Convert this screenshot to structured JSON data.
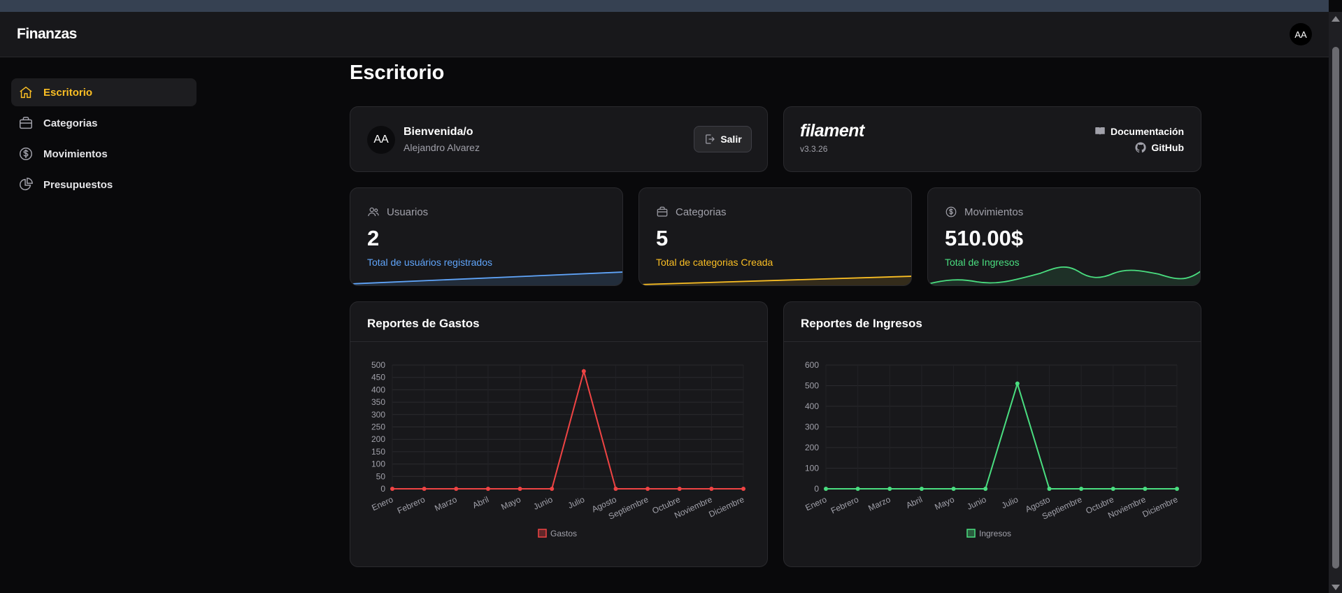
{
  "app": {
    "brand": "Finanzas",
    "user_initials": "AA"
  },
  "sidebar": {
    "items": [
      {
        "label": "Escritorio",
        "icon": "home-icon",
        "active": true
      },
      {
        "label": "Categorias",
        "icon": "briefcase-icon",
        "active": false
      },
      {
        "label": "Movimientos",
        "icon": "dollar-circle-icon",
        "active": false
      },
      {
        "label": "Presupuestos",
        "icon": "pie-chart-icon",
        "active": false
      }
    ]
  },
  "page": {
    "title": "Escritorio"
  },
  "account_widget": {
    "initials": "AA",
    "welcome": "Bienvenida/o",
    "user_name": "Alejandro Alvarez",
    "logout_label": "Salir"
  },
  "filament_widget": {
    "logo_text": "filament",
    "version": "v3.3.26",
    "docs_label": "Documentación",
    "github_label": "GitHub"
  },
  "stats": [
    {
      "label": "Usuarios",
      "icon": "users-icon",
      "value": "2",
      "description": "Total de usuários registrados",
      "color": "#60a5fa"
    },
    {
      "label": "Categorias",
      "icon": "briefcase-icon",
      "value": "5",
      "description": "Total de categorias Creada",
      "color": "#fbbf24"
    },
    {
      "label": "Movimientos",
      "icon": "dollar-circle-icon",
      "value": "510.00$",
      "description": "Total de Ingresos",
      "color": "#4ade80"
    }
  ],
  "colors": {
    "accent": "#fbbf24",
    "gastos": "#ef4444",
    "ingresos": "#4ade80",
    "usuarios": "#60a5fa"
  },
  "chart_data": [
    {
      "type": "line",
      "title": "Reportes de Gastos",
      "categories": [
        "Enero",
        "Febrero",
        "Marzo",
        "Abril",
        "Mayo",
        "Junio",
        "Julio",
        "Agosto",
        "Septiembre",
        "Octubre",
        "Noviembre",
        "Diciembre"
      ],
      "series": [
        {
          "name": "Gastos",
          "values": [
            0,
            0,
            0,
            0,
            0,
            0,
            475,
            0,
            0,
            0,
            0,
            0
          ],
          "color": "#ef4444"
        }
      ],
      "yticks": [
        0,
        50,
        100,
        150,
        200,
        250,
        300,
        350,
        400,
        450,
        500
      ],
      "ylim": [
        0,
        500
      ],
      "grid": true,
      "legend": "bottom-center"
    },
    {
      "type": "line",
      "title": "Reportes de Ingresos",
      "categories": [
        "Enero",
        "Febrero",
        "Marzo",
        "Abril",
        "Mayo",
        "Junio",
        "Julio",
        "Agosto",
        "Septiembre",
        "Octubre",
        "Noviembre",
        "Diciembre"
      ],
      "series": [
        {
          "name": "Ingresos",
          "values": [
            0,
            0,
            0,
            0,
            0,
            0,
            510,
            0,
            0,
            0,
            0,
            0
          ],
          "color": "#4ade80"
        }
      ],
      "yticks": [
        0,
        100,
        200,
        300,
        400,
        500,
        600
      ],
      "ylim": [
        0,
        600
      ],
      "grid": true,
      "legend": "bottom-center"
    }
  ]
}
